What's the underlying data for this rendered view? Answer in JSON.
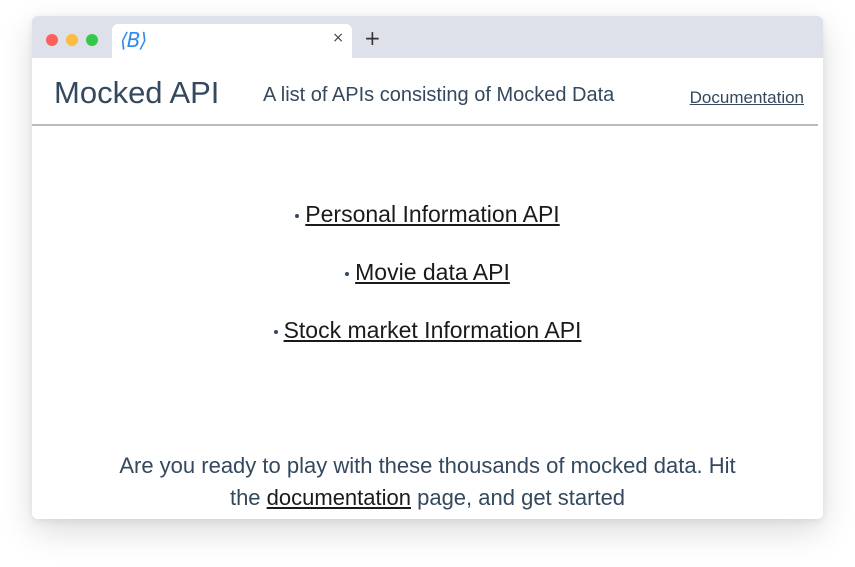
{
  "browser": {
    "tab_favicon": "⟨B⟩",
    "tab_close": "×",
    "new_tab": "+"
  },
  "header": {
    "brand": "Mocked API",
    "tagline": "A list of APIs consisting of Mocked Data",
    "doc_link": "Documentation"
  },
  "apis": [
    {
      "label": "Personal Information API"
    },
    {
      "label": "Movie data API"
    },
    {
      "label": "Stock market Information API"
    }
  ],
  "cta": {
    "line1": "Are you ready to play with these thousands of mocked data. Hit",
    "pre_link": "the ",
    "link": "documentation",
    "post_link": " page, and get started"
  },
  "colors": {
    "text": "#34495e",
    "favicon": "#2d8bf0",
    "traffic_close": "#fc605c",
    "traffic_min": "#fdbc40",
    "traffic_max": "#34c84a"
  }
}
